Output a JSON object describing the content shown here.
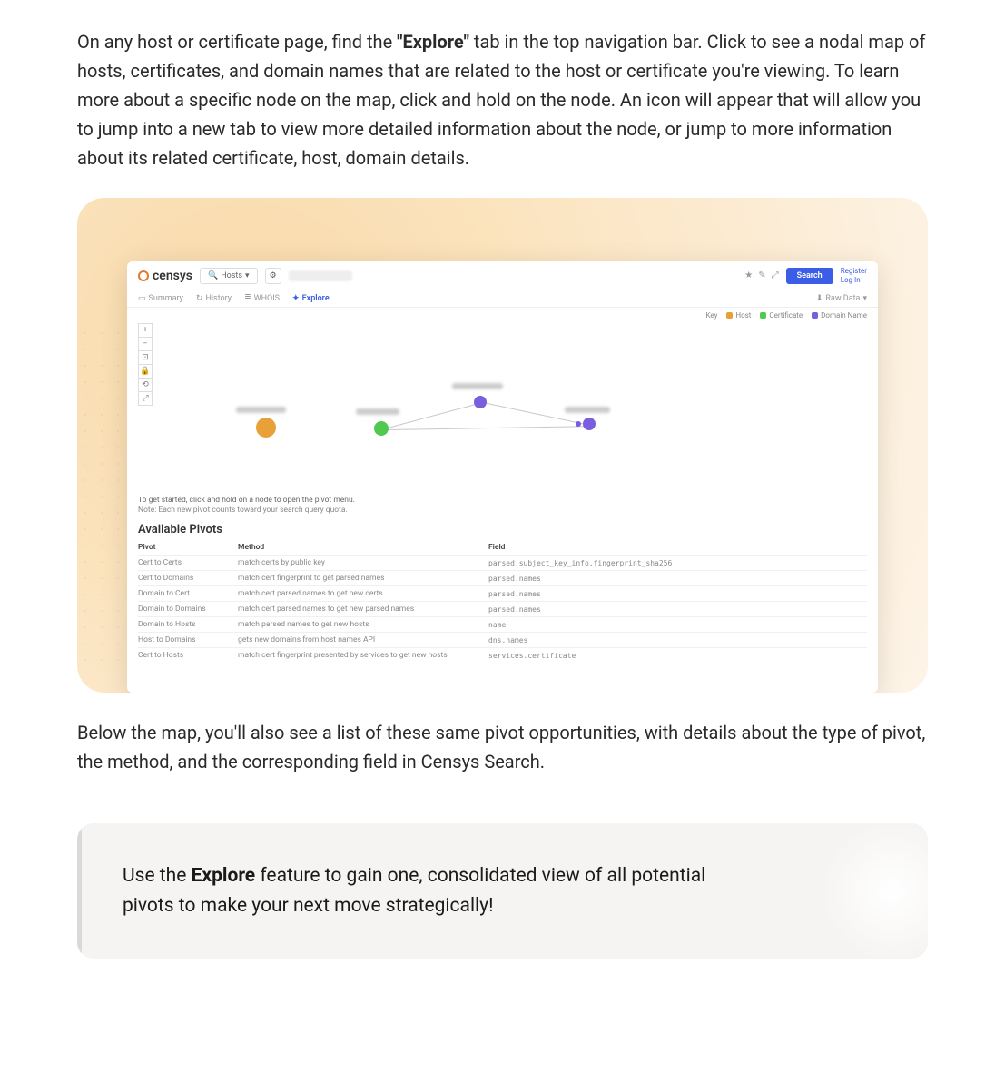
{
  "para1_pre": "On any host or certificate page, find the ",
  "para1_bold": "\"Explore\"",
  "para1_post": " tab in the top navigation bar. Click to see a nodal map of hosts, certificates, and domain names that are related to the host or certificate you're viewing. To learn more about a specific node on the map, click and hold on the node. An icon will appear that will allow you to jump into a new tab to view more detailed information about the node, or jump to more information about its related certificate, host, domain details.",
  "para2": "Below the map, you'll also see a list of these same pivot opportunities, with details about the type of pivot, the method, and the corresponding field in Censys Search.",
  "callout_pre": "Use the ",
  "callout_bold": "Explore",
  "callout_post": " feature to gain one, consolidated view of all potential pivots to make your next move strategically!",
  "app": {
    "brand": "censys",
    "scope": "Hosts",
    "search_btn": "Search",
    "register": "Register",
    "login": "Log In",
    "tabs": {
      "summary": "Summary",
      "history": "History",
      "whois": "WHOIS",
      "explore": "Explore",
      "rawdata": "Raw Data"
    },
    "key": {
      "label": "Key",
      "host": "Host",
      "cert": "Certificate",
      "domain": "Domain Name"
    },
    "colors": {
      "host": "#e8a038",
      "cert": "#4fc94f",
      "domain": "#7a5ee0"
    },
    "hint_line1": "To get started, click and hold on a node to open the pivot menu.",
    "hint_line2": "Note: Each new pivot counts toward your search query quota.",
    "pivots_title": "Available Pivots",
    "pivots_headers": {
      "pivot": "Pivot",
      "method": "Method",
      "field": "Field"
    },
    "pivots": [
      {
        "pivot": "Cert to Certs",
        "method": "match certs by public key",
        "dot": "#4fc94f",
        "field": "parsed.subject_key_info.fingerprint_sha256"
      },
      {
        "pivot": "Cert to Domains",
        "method": "match cert fingerprint to get parsed names",
        "dot": "#4fc94f",
        "field": "parsed.names"
      },
      {
        "pivot": "Domain to Cert",
        "method": "match cert parsed names to get new certs",
        "dot": "#4fc94f",
        "field": "parsed.names"
      },
      {
        "pivot": "Domain to Domains",
        "method": "match cert parsed names to get new parsed names",
        "dot": "#4fc94f",
        "field": "parsed.names"
      },
      {
        "pivot": "Domain to Hosts",
        "method": "match parsed names to get new hosts",
        "dot": "#e8a038",
        "field": "name"
      },
      {
        "pivot": "Host to Domains",
        "method": "gets new domains from host names API",
        "dot": "#e8a038",
        "field": "dns.names"
      },
      {
        "pivot": "Cert to Hosts",
        "method": "match cert fingerprint presented by services to get new hosts",
        "dot": "#e8a038",
        "field": "services.certificate"
      }
    ]
  }
}
